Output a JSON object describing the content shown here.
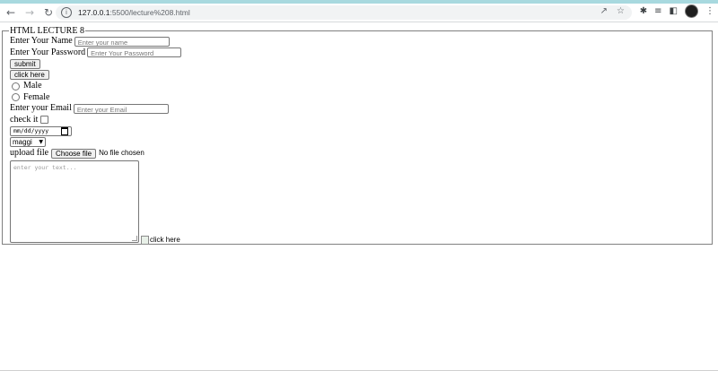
{
  "browser": {
    "url_host": "127.0.0.1",
    "url_path": ":5500/lecture%208.html"
  },
  "fieldset": {
    "legend": "HTML LECTURE 8",
    "name_label": "Enter Your Name",
    "name_placeholder": "Enter your name",
    "password_label": "Enter Your Password",
    "password_placeholder": "Enter Your Password",
    "submit_label": "submit",
    "click_label": "click here",
    "radio_male": "Male",
    "radio_female": "Female",
    "email_label": "Enter your Email",
    "email_placeholder": "Enter your Email",
    "check_label": "check it",
    "date_placeholder": "mm/dd/yyyy",
    "select_value": "maggi",
    "upload_label": "upload file",
    "choose_file": "Choose file",
    "no_file": "No file chosen",
    "textarea_placeholder": "enter your text...",
    "image_alt": "click here"
  }
}
